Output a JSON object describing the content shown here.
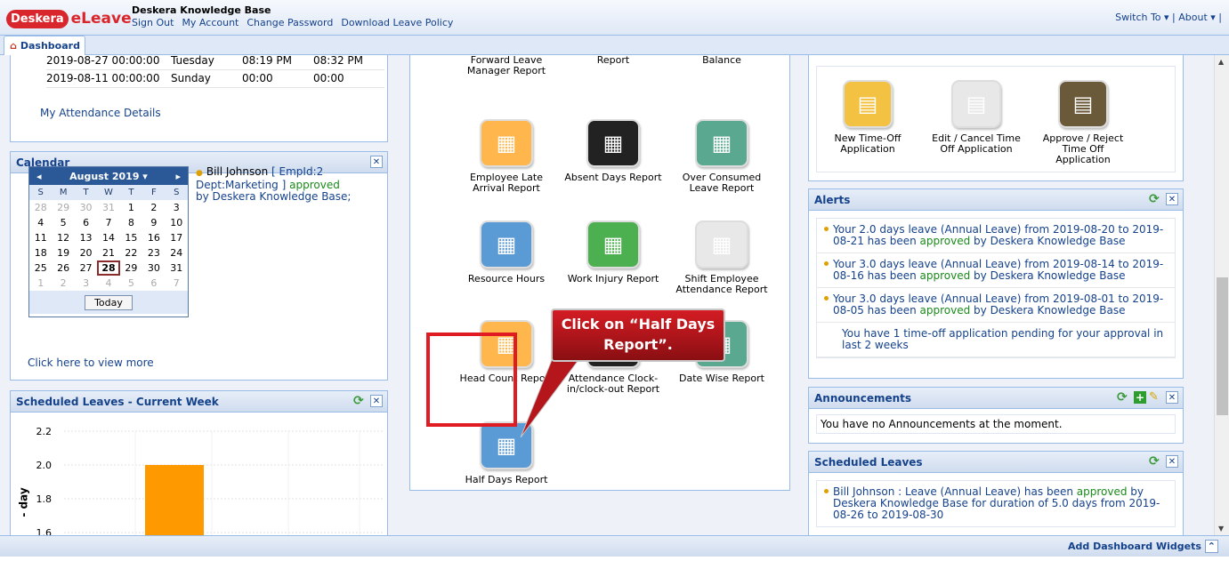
{
  "header": {
    "logo_badge": "Deskera",
    "app_name": "eLeave",
    "company": "Deskera Knowledge Base",
    "links": [
      "Sign Out",
      "My Account",
      "Change Password",
      "Download Leave Policy"
    ],
    "right_links": "Switch To ▾  |  About ▾  |"
  },
  "tab": {
    "label": "Dashboard"
  },
  "attendance": {
    "rows": [
      {
        "date": "2019-08-27 00:00:00",
        "day": "Tuesday",
        "in": "08:19 PM",
        "out": "08:32 PM"
      },
      {
        "date": "2019-08-11 00:00:00",
        "day": "Sunday",
        "in": "00:00",
        "out": "00:00"
      }
    ],
    "link": "My Attendance Details"
  },
  "calendar": {
    "title": "Calendar",
    "month": "August 2019 ▾",
    "dow": [
      "S",
      "M",
      "T",
      "W",
      "T",
      "F",
      "S"
    ],
    "weeks": [
      [
        "28",
        "29",
        "30",
        "31",
        "1",
        "2",
        "3"
      ],
      [
        "4",
        "5",
        "6",
        "7",
        "8",
        "9",
        "10"
      ],
      [
        "11",
        "12",
        "13",
        "14",
        "15",
        "16",
        "17"
      ],
      [
        "18",
        "19",
        "20",
        "21",
        "22",
        "23",
        "24"
      ],
      [
        "25",
        "26",
        "27",
        "28",
        "29",
        "30",
        "31"
      ],
      [
        "1",
        "2",
        "3",
        "4",
        "5",
        "6",
        "7"
      ]
    ],
    "today_button": "Today",
    "event_name": "Bill Johnson",
    "event_detail": "[ EmpId:2 Dept:Marketing ]",
    "event_status": "approved",
    "event_by": "by Deskera Knowledge Base;",
    "view_more": "Click here to view more"
  },
  "scheduled_week": {
    "title": "Scheduled Leaves - Current Week",
    "y_ticks": [
      "2.2",
      "2.0",
      "1.8",
      "1.6"
    ],
    "ylabel": "- day"
  },
  "chart_data": {
    "type": "bar",
    "title": "Scheduled Leaves - Current Week",
    "ylabel": "- day",
    "categories": [
      ""
    ],
    "values": [
      2.0
    ],
    "ylim": [
      1.6,
      2.2
    ],
    "color": "#ff9900"
  },
  "reports": [
    {
      "label": "Balance Carry Forward Leave Manager Report"
    },
    {
      "label": "Attendance Details Report"
    },
    {
      "label": "Employee Leave Balance"
    },
    {
      "label": "Employee Late Arrival Report"
    },
    {
      "label": "Absent Days Report"
    },
    {
      "label": "Over Consumed Leave Report"
    },
    {
      "label": "Resource Hours"
    },
    {
      "label": "Work Injury Report"
    },
    {
      "label": "Shift Employee Attendance Report"
    },
    {
      "label": "Head Count Report"
    },
    {
      "label": "Attendance Clock-in/clock-out Report"
    },
    {
      "label": "Date Wise Report"
    },
    {
      "label": "Half Days Report"
    }
  ],
  "timeoff": {
    "items": [
      "New Time-Off Application",
      "Edit / Cancel Time Off Application",
      "Approve / Reject Time Off Application"
    ]
  },
  "alerts": {
    "title": "Alerts",
    "items": [
      {
        "pre": "Your 2.0 days leave (Annual Leave) from 2019-08-20 to 2019-08-21 has been ",
        "status": "approved",
        "post": " by Deskera Knowledge Base"
      },
      {
        "pre": "Your 3.0 days leave (Annual Leave) from 2019-08-14 to 2019-08-16 has been ",
        "status": "approved",
        "post": " by Deskera Knowledge Base"
      },
      {
        "pre": "Your 3.0 days leave (Annual Leave) from 2019-08-01 to 2019-08-05 has been ",
        "status": "approved",
        "post": " by Deskera Knowledge Base"
      }
    ],
    "pending": "You have 1 time-off application pending for your approval in last 2 weeks"
  },
  "announcements": {
    "title": "Announcements",
    "text": "You have no Announcements at the moment."
  },
  "scheduled": {
    "title": "Scheduled Leaves",
    "pre": "Bill Johnson : Leave (Annual Leave) has been ",
    "status": "approved",
    "post": " by Deskera Knowledge Base for duration of 5.0 days from 2019-08-26 to 2019-08-30"
  },
  "footer": {
    "add_widgets": "Add Dashboard Widgets"
  },
  "callout": {
    "text": "Click on “Half Days Report”."
  }
}
